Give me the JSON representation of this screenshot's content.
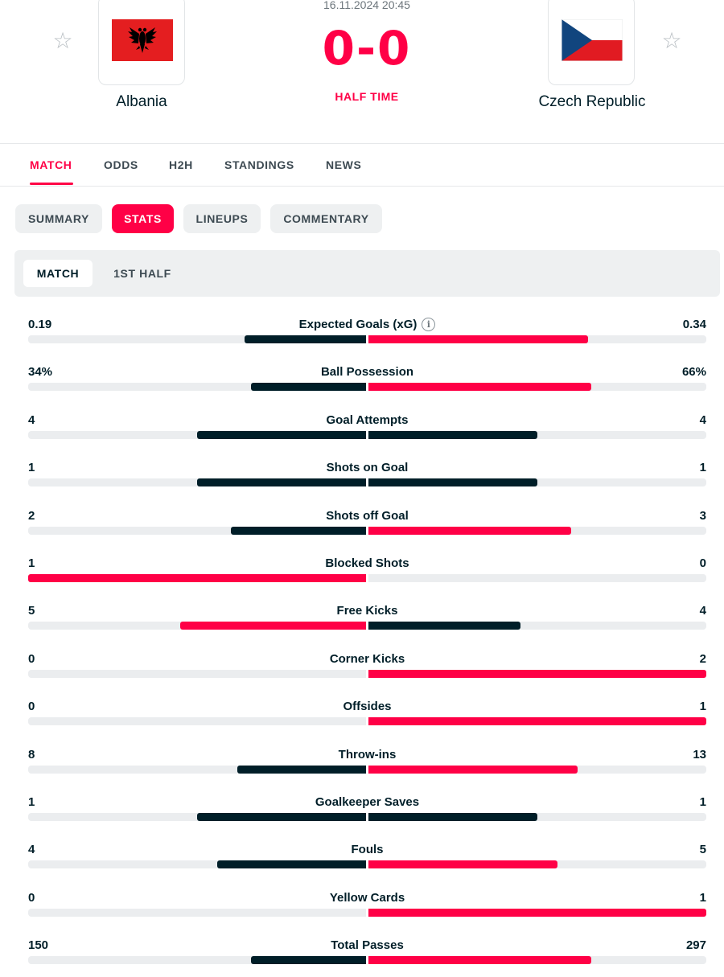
{
  "match": {
    "datetime": "16.11.2024 20:45",
    "score": "0-0",
    "status": "HALF TIME",
    "home": {
      "name": "Albania"
    },
    "away": {
      "name": "Czech Republic"
    }
  },
  "tabs": [
    {
      "label": "MATCH",
      "active": true
    },
    {
      "label": "ODDS"
    },
    {
      "label": "H2H"
    },
    {
      "label": "STANDINGS"
    },
    {
      "label": "NEWS"
    }
  ],
  "subtabs": [
    {
      "label": "SUMMARY"
    },
    {
      "label": "STATS",
      "active": true
    },
    {
      "label": "LINEUPS"
    },
    {
      "label": "COMMENTARY"
    }
  ],
  "periods": [
    {
      "label": "MATCH",
      "active": true
    },
    {
      "label": "1ST HALF"
    }
  ],
  "colors": {
    "accent": "#ff0046",
    "dark": "#001e28",
    "track": "#ebedef"
  },
  "stats": [
    {
      "name": "Expected Goals (xG)",
      "home": "0.19",
      "away": "0.34",
      "h": 0.19,
      "a": 0.34,
      "info": true,
      "home_pct": 0.36,
      "away_pct": 0.65
    },
    {
      "name": "Ball Possession",
      "home": "34%",
      "away": "66%",
      "h": 34,
      "a": 66,
      "home_pct": 0.34,
      "away_pct": 0.66
    },
    {
      "name": "Goal Attempts",
      "home": "4",
      "away": "4",
      "h": 4,
      "a": 4,
      "home_pct": 0.5,
      "away_pct": 0.5
    },
    {
      "name": "Shots on Goal",
      "home": "1",
      "away": "1",
      "h": 1,
      "a": 1,
      "home_pct": 0.5,
      "away_pct": 0.5
    },
    {
      "name": "Shots off Goal",
      "home": "2",
      "away": "3",
      "h": 2,
      "a": 3,
      "home_pct": 0.4,
      "away_pct": 0.6
    },
    {
      "name": "Blocked Shots",
      "home": "1",
      "away": "0",
      "h": 1,
      "a": 0,
      "home_pct": 1.0,
      "away_pct": 0.0
    },
    {
      "name": "Free Kicks",
      "home": "5",
      "away": "4",
      "h": 5,
      "a": 4,
      "home_pct": 0.55,
      "away_pct": 0.45
    },
    {
      "name": "Corner Kicks",
      "home": "0",
      "away": "2",
      "h": 0,
      "a": 2,
      "home_pct": 0.0,
      "away_pct": 1.0
    },
    {
      "name": "Offsides",
      "home": "0",
      "away": "1",
      "h": 0,
      "a": 1,
      "home_pct": 0.0,
      "away_pct": 1.0
    },
    {
      "name": "Throw-ins",
      "home": "8",
      "away": "13",
      "h": 8,
      "a": 13,
      "home_pct": 0.38,
      "away_pct": 0.62
    },
    {
      "name": "Goalkeeper Saves",
      "home": "1",
      "away": "1",
      "h": 1,
      "a": 1,
      "home_pct": 0.5,
      "away_pct": 0.5
    },
    {
      "name": "Fouls",
      "home": "4",
      "away": "5",
      "h": 4,
      "a": 5,
      "home_pct": 0.44,
      "away_pct": 0.56
    },
    {
      "name": "Yellow Cards",
      "home": "0",
      "away": "1",
      "h": 0,
      "a": 1,
      "home_pct": 0.0,
      "away_pct": 1.0
    },
    {
      "name": "Total Passes",
      "home": "150",
      "away": "297",
      "h": 150,
      "a": 297,
      "home_pct": 0.34,
      "away_pct": 0.66
    }
  ]
}
